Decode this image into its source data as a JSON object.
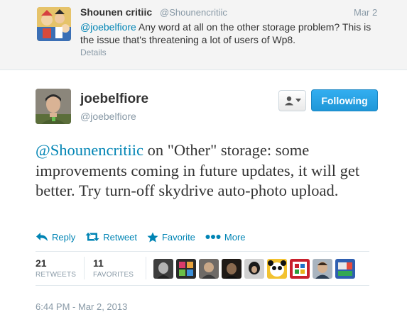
{
  "parent_tweet": {
    "name": "Shounen critiic",
    "handle": "@Shounencritiic",
    "date": "Mar 2",
    "mention": "@joebelfiore",
    "text": " Any word at all on the other storage problem? This is the issue that's threatening a lot of users of Wp8.",
    "details_label": "Details"
  },
  "main_tweet": {
    "name": "joebelfiore",
    "handle": "@joebelfiore",
    "follow_label": "Following",
    "mention": "@Shounencritiic",
    "text": " on \"Other\" storage: some improvements coming in future updates, it will get better. Try turn-off skydrive auto-photo upload.",
    "actions": {
      "reply": "Reply",
      "retweet": "Retweet",
      "favorite": "Favorite",
      "more": "More"
    },
    "stats": {
      "retweets_count": "21",
      "retweets_label": "RETWEETS",
      "favorites_count": "11",
      "favorites_label": "FAVORITES"
    },
    "timestamp": "6:44 PM - Mar 2, 2013"
  },
  "colors": {
    "link": "#0084b4",
    "follow_button": "#2aa3e6",
    "muted": "#8899a6"
  },
  "icons": {
    "reply": "reply-arrow-icon",
    "retweet": "retweet-icon",
    "favorite": "star-icon",
    "more": "ellipsis-icon",
    "user_menu": "user-icon",
    "caret": "caret-down-icon"
  }
}
